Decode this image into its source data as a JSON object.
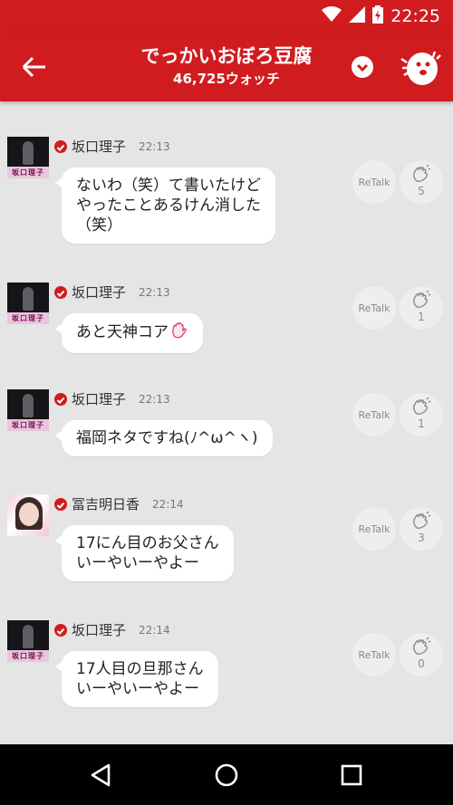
{
  "status": {
    "time": "22:25"
  },
  "header": {
    "title": "でっかいおぼろ豆腐",
    "watch_count": "46,725ウォッチ"
  },
  "messages": [
    {
      "name": "坂口理子",
      "time": "22:13",
      "text": "ないわ（笑）て書いたけど\nやったことあるけん消した\n（笑）",
      "retalk": "ReTalk",
      "claps": "5",
      "avatar_label": "坂口理子"
    },
    {
      "name": "坂口理子",
      "time": "22:13",
      "text": "あと天神コア",
      "retalk": "ReTalk",
      "claps": "1",
      "avatar_label": "坂口理子"
    },
    {
      "name": "坂口理子",
      "time": "22:13",
      "text": "福岡ネタですね(ﾉ^ω^ヽ)",
      "retalk": "ReTalk",
      "claps": "1",
      "avatar_label": "坂口理子"
    },
    {
      "name": "冨吉明日香",
      "time": "22:14",
      "text": "17にん目のお父さん\nいーやいーやよー",
      "retalk": "ReTalk",
      "claps": "3"
    },
    {
      "name": "坂口理子",
      "time": "22:14",
      "text": "17人目の旦那さん\nいーやいーやよー",
      "retalk": "ReTalk",
      "claps": "0",
      "avatar_label": "坂口理子"
    }
  ],
  "colors": {
    "brand": "#d01c1f",
    "background": "#e5e5e5",
    "bubble": "#ffffff"
  }
}
